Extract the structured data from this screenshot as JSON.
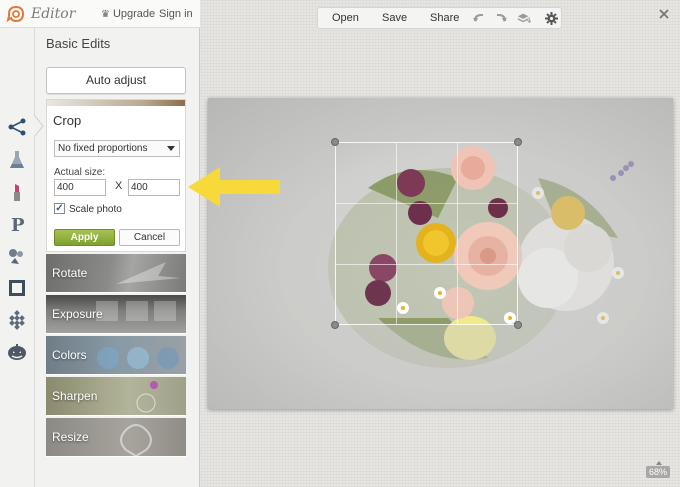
{
  "app": {
    "brand": "Editor",
    "upgrade_label": "Upgrade",
    "signin_label": "Sign in"
  },
  "sidebar": {
    "section_title": "Basic Edits",
    "auto_adjust_label": "Auto adjust",
    "rail_icons": [
      "connect-nodes-icon",
      "flask-icon",
      "lipstick-icon",
      "text-p-icon",
      "stickers-icon",
      "frame-icon",
      "texture-icon",
      "pumpkin-icon"
    ],
    "crop": {
      "title": "Crop",
      "proportion_selected": "No fixed proportions",
      "size_label": "Actual size:",
      "width_value": "400",
      "height_value": "400",
      "times_symbol": "X",
      "scale_photo_label": "Scale photo",
      "scale_photo_checked": true,
      "apply_label": "Apply",
      "cancel_label": "Cancel"
    },
    "tools": [
      {
        "label": "Rotate"
      },
      {
        "label": "Exposure"
      },
      {
        "label": "Colors"
      },
      {
        "label": "Sharpen"
      },
      {
        "label": "Resize"
      }
    ]
  },
  "toolbar": {
    "open_label": "Open",
    "save_label": "Save",
    "share_label": "Share"
  },
  "canvas": {
    "zoom_label": "68%"
  },
  "colors": {
    "apply_green": "#8bac3a",
    "arrow_yellow": "#f7d93a",
    "panel_bg": "#f2f2f0",
    "canvas_bg": "#e6e5e1"
  }
}
